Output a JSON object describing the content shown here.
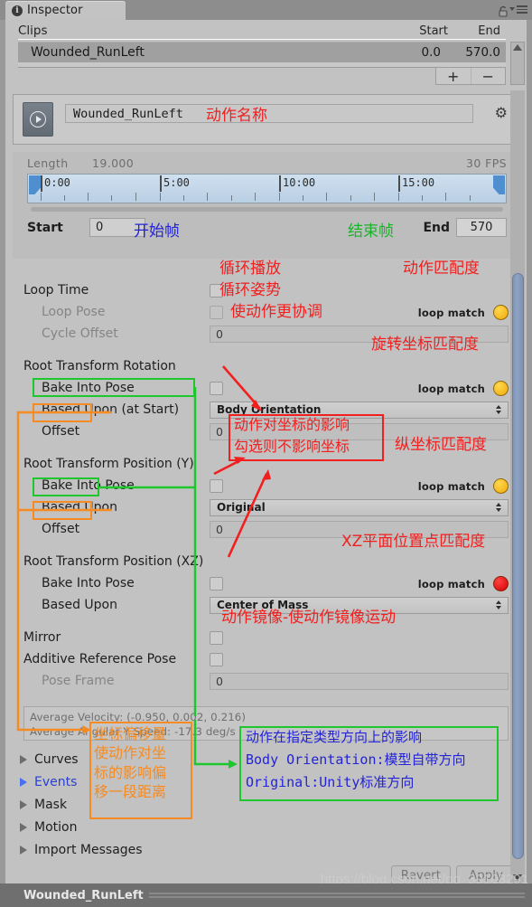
{
  "window": {
    "tab_label": "Inspector",
    "info_icon": "info-icon",
    "lock_icon": "lock-icon",
    "menu_icon": "hamburger-menu-icon"
  },
  "clips_list": {
    "columns": [
      "Clips",
      "Start",
      "End"
    ],
    "rows": [
      {
        "name": "Wounded_RunLeft",
        "start": "0.0",
        "end": "570.0"
      }
    ],
    "add_label": "+",
    "remove_label": "−"
  },
  "clip_header": {
    "play_icon": "play-icon",
    "clip_name": "Wounded_RunLeft",
    "gear_icon": "gear-icon"
  },
  "timeline": {
    "length_label": "Length",
    "length_value": "19.000",
    "fps_label": "30 FPS",
    "ticks": [
      "0:00",
      "5:00",
      "10:00",
      "15:00"
    ],
    "start_label": "Start",
    "start_value": "0",
    "end_label": "End",
    "end_value": "570"
  },
  "properties": {
    "loop_time": {
      "label": "Loop Time",
      "checked": false
    },
    "loop_pose": {
      "label": "Loop Pose",
      "checked": false,
      "disabled": true
    },
    "cycle_offset": {
      "label": "Cycle Offset",
      "value": "0",
      "disabled": true
    },
    "root_rotation": {
      "header": "Root Transform Rotation",
      "bake_label": "Bake Into Pose",
      "bake_checked": false,
      "based_upon_label": "Based Upon (at Start)",
      "based_upon_value": "Body Orientation",
      "offset_label": "Offset",
      "offset_value": "0"
    },
    "root_position_y": {
      "header": "Root Transform Position (Y)",
      "bake_label": "Bake Into Pose",
      "bake_checked": false,
      "based_upon_label": "Based Upon",
      "based_upon_value": "Original",
      "offset_label": "Offset",
      "offset_value": "0"
    },
    "root_position_xz": {
      "header": "Root Transform Position (XZ)",
      "bake_label": "Bake Into Pose",
      "bake_checked": false,
      "based_upon_label": "Based Upon",
      "based_upon_value": "Center of Mass"
    },
    "mirror": {
      "label": "Mirror",
      "checked": false
    },
    "additive_reference_pose": {
      "label": "Additive Reference Pose",
      "checked": false
    },
    "pose_frame": {
      "label": "Pose Frame",
      "value": "0",
      "disabled": true
    },
    "loop_match_label": "loop match",
    "loop_match_colors": {
      "amber": "#f0a90a",
      "red": "#d40000"
    },
    "stats": {
      "line1": "Average Velocity: (-0.950, 0.002, 0.216)",
      "line2": "Average Angular Y Speed: -17.3 deg/s"
    }
  },
  "foldouts": [
    {
      "label": "Curves",
      "highlight": false
    },
    {
      "label": "Events",
      "highlight": true
    },
    {
      "label": "Mask",
      "highlight": false
    },
    {
      "label": "Motion",
      "highlight": false
    },
    {
      "label": "Import Messages",
      "highlight": false
    }
  ],
  "footer": {
    "revert_label": "Revert",
    "apply_label": "Apply",
    "status_name": "Wounded_RunLeft",
    "watermark": "https://blog.csdn.net/qq_39108291"
  },
  "annotations": {
    "clip_name_note": "动作名称",
    "start_frame_note": "开始帧",
    "end_frame_note": "结束帧",
    "loop_playback": "循环播放",
    "loop_pose_note": "循环姿势",
    "cycle_offset_note": "使动作更协调",
    "motion_match": "动作匹配度",
    "rotation_match": "旋转坐标匹配度",
    "y_match": "纵坐标匹配度",
    "xz_match": "XZ平面位置点匹配度",
    "mirror_note": "动作镜像-使动作镜像运动",
    "red_box_line1": "动作对坐标的影响",
    "red_box_line2": "勾选则不影响坐标",
    "orange_box": "坐标偏移量\n使动作对坐\n标的影响偏\n移一段距离",
    "green_box_line1": "动作在指定类型方向上的影响",
    "green_box_line2": "Body Orientation:模型自带方向",
    "green_box_line3": "Original:Unity标准方向"
  }
}
